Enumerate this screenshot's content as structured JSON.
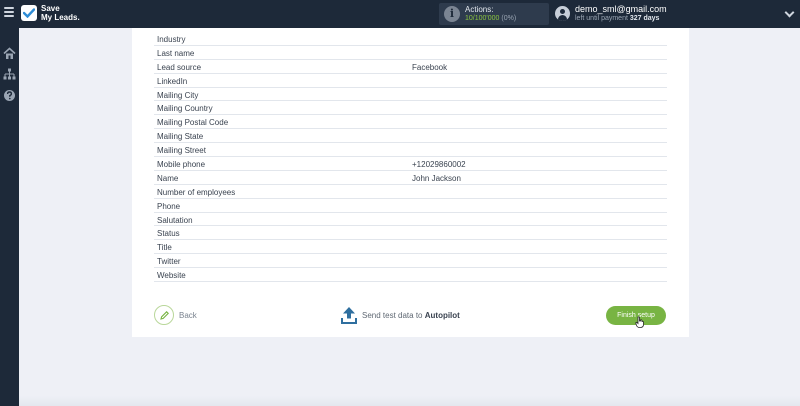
{
  "app": {
    "logo_line1": "Save",
    "logo_line2": "My Leads."
  },
  "header": {
    "actions_label": "Actions:",
    "actions_used": "10",
    "actions_total": "/100'000",
    "actions_percent": "(0%)",
    "user_email": "demo_sml@gmail.com",
    "payment_prefix": "left until payment",
    "payment_days": "327 days"
  },
  "fields": [
    {
      "name": "Industry",
      "value": ""
    },
    {
      "name": "Last name",
      "value": ""
    },
    {
      "name": "Lead source",
      "value": "Facebook"
    },
    {
      "name": "LinkedIn",
      "value": ""
    },
    {
      "name": "Mailing City",
      "value": ""
    },
    {
      "name": "Mailing Country",
      "value": ""
    },
    {
      "name": "Mailing Postal Code",
      "value": ""
    },
    {
      "name": "Mailing State",
      "value": ""
    },
    {
      "name": "Mailing Street",
      "value": ""
    },
    {
      "name": "Mobile phone",
      "value": "+12029860002"
    },
    {
      "name": "Name",
      "value": "John Jackson"
    },
    {
      "name": "Number of employees",
      "value": ""
    },
    {
      "name": "Phone",
      "value": ""
    },
    {
      "name": "Salutation",
      "value": ""
    },
    {
      "name": "Status",
      "value": ""
    },
    {
      "name": "Title",
      "value": ""
    },
    {
      "name": "Twitter",
      "value": ""
    },
    {
      "name": "Website",
      "value": ""
    }
  ],
  "footer": {
    "back_label": "Back",
    "test_prefix": "Send test data to",
    "test_target": "Autopilot",
    "finish_label": "Finish setup"
  },
  "icons": {
    "menu": "hamburger-icon",
    "logo": "checkmark-logo-icon",
    "actions": "info-icon",
    "user": "user-avatar-icon",
    "dropdown": "chevron-down-icon",
    "home": "home-icon",
    "sitemap": "sitemap-icon",
    "help": "help-icon",
    "back": "pencil-icon",
    "upload": "upload-icon"
  },
  "colors": {
    "topbar": "#1d2939",
    "accent_green": "#78b443",
    "upload_blue": "#2f6f9f"
  }
}
